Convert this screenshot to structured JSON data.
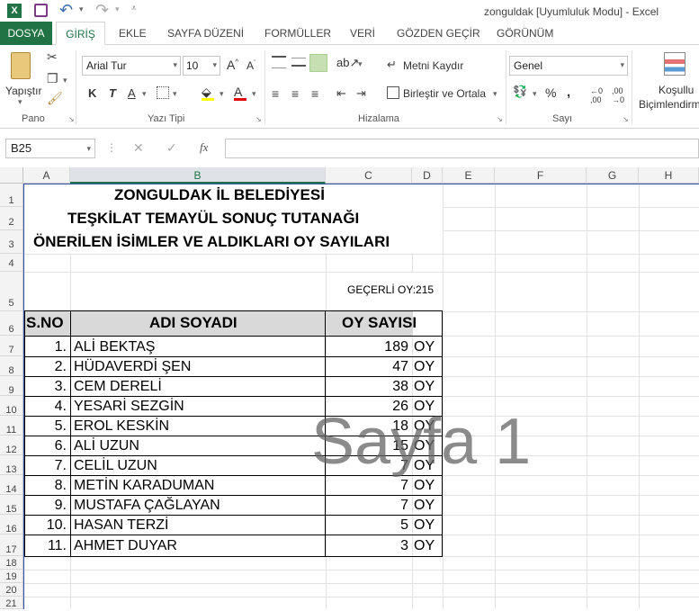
{
  "window": {
    "title": "zonguldak  [Uyumluluk Modu] - Excel"
  },
  "tabs": [
    "DOSYA",
    "GİRİŞ",
    "EKLE",
    "SAYFA DÜZENİ",
    "FORMÜLLER",
    "VERİ",
    "GÖZDEN GEÇİR",
    "GÖRÜNÜM"
  ],
  "ribbon": {
    "paste_label": "Yapıştır",
    "font_name": "Arial Tur",
    "font_size": "10",
    "bold": "K",
    "italic": "T",
    "underline": "A",
    "wrap_text": "Metni Kaydır",
    "merge_center": "Birleştir ve Ortala",
    "number_format": "Genel",
    "conditional_label": "Koşullu",
    "conditional_label2": "Biçimlendirm",
    "groups": {
      "clipboard": "Pano",
      "font": "Yazı Tipi",
      "alignment": "Hizalama",
      "number": "Sayı"
    }
  },
  "formula_bar": {
    "name_box": "B25",
    "fx": "fx",
    "content": ""
  },
  "columns": [
    "A",
    "B",
    "C",
    "D",
    "E",
    "F",
    "G",
    "H"
  ],
  "rows": [
    "1",
    "2",
    "3",
    "4",
    "5",
    "6",
    "7",
    "8",
    "9",
    "10",
    "11",
    "12",
    "13",
    "14",
    "15",
    "16",
    "17",
    "18",
    "19",
    "20",
    "21"
  ],
  "sheet": {
    "title1": "ZONGULDAK İL BELEDİYESİ",
    "title2": "TEŞKİLAT TEMAYÜL SONUÇ TUTANAĞI",
    "title3": "ÖNERİLEN İSİMLER VE ALDIKLARI OY SAYILARI",
    "valid_votes": "GEÇERLİ OY:215",
    "header": {
      "no": "S.NO",
      "name": "ADI SOYADI",
      "votes": "OY SAYISI"
    },
    "unit": "OY",
    "entries": [
      {
        "no": "1.",
        "name": "ALİ BEKTAŞ",
        "votes": "189"
      },
      {
        "no": "2.",
        "name": "HÜDAVERDİ ŞEN",
        "votes": "47"
      },
      {
        "no": "3.",
        "name": "CEM DERELİ",
        "votes": "38"
      },
      {
        "no": "4.",
        "name": "YESARİ SEZGİN",
        "votes": "26"
      },
      {
        "no": "5.",
        "name": "EROL KESKİN",
        "votes": "18"
      },
      {
        "no": "6.",
        "name": "ALİ UZUN",
        "votes": "15"
      },
      {
        "no": "7.",
        "name": "CELİL UZUN",
        "votes": "7"
      },
      {
        "no": "8.",
        "name": "METİN KARADUMAN",
        "votes": "7"
      },
      {
        "no": "9.",
        "name": "MUSTAFA ÇAĞLAYAN",
        "votes": "7"
      },
      {
        "no": "10.",
        "name": "HASAN TERZİ",
        "votes": "5"
      },
      {
        "no": "11.",
        "name": "AHMET DUYAR",
        "votes": "3"
      }
    ],
    "watermark": "Sayfa 1"
  }
}
